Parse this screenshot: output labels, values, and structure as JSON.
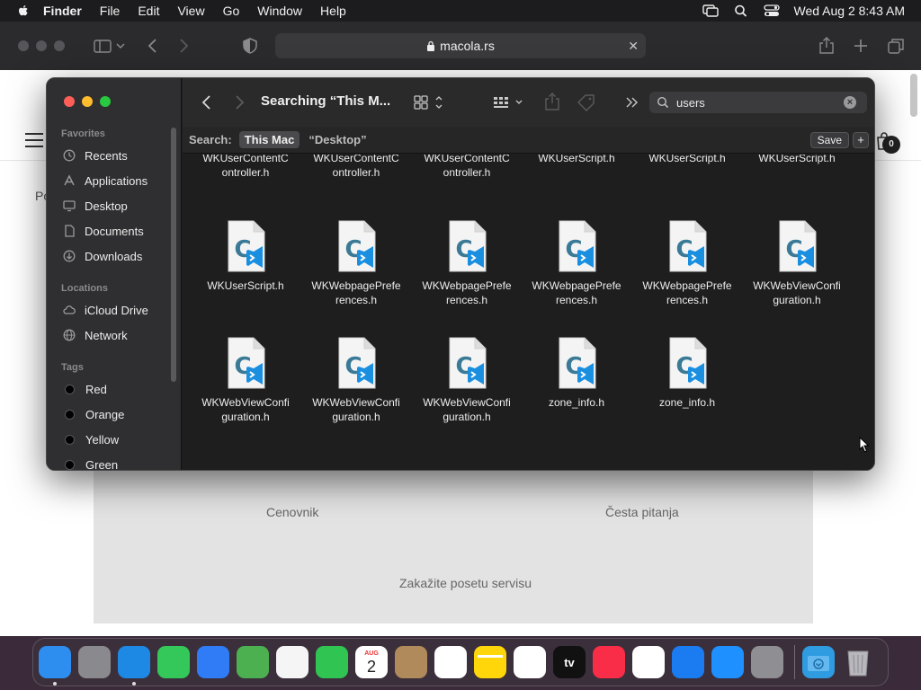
{
  "menubar": {
    "app": "Finder",
    "items": [
      "File",
      "Edit",
      "View",
      "Go",
      "Window",
      "Help"
    ],
    "datetime": "Wed Aug 2  8:43 AM"
  },
  "safari": {
    "url": "macola.rs",
    "cart_count": "0",
    "po_text": "Po",
    "links": {
      "pricing": "Cenovnik",
      "faq": "Česta pitanja",
      "service": "Zakažite posetu servisu"
    }
  },
  "finder": {
    "title": "Searching “This M...",
    "search_value": "users",
    "scope": {
      "label": "Search:",
      "selected": "This Mac",
      "other": "“Desktop”",
      "save": "Save",
      "add": "+"
    },
    "sidebar": {
      "favorites_header": "Favorites",
      "favorites": [
        {
          "label": "Recents",
          "icon": "clock-icon"
        },
        {
          "label": "Applications",
          "icon": "applications-icon"
        },
        {
          "label": "Desktop",
          "icon": "desktop-icon"
        },
        {
          "label": "Documents",
          "icon": "document-icon"
        },
        {
          "label": "Downloads",
          "icon": "download-icon"
        }
      ],
      "locations_header": "Locations",
      "locations": [
        {
          "label": "iCloud Drive",
          "icon": "cloud-icon"
        },
        {
          "label": "Network",
          "icon": "network-icon"
        }
      ],
      "tags_header": "Tags",
      "tags": [
        {
          "label": "Red"
        },
        {
          "label": "Orange"
        },
        {
          "label": "Yellow"
        },
        {
          "label": "Green"
        }
      ]
    },
    "files": [
      {
        "line1": "WKUserContentC",
        "line2": "ontroller.h",
        "partial": true
      },
      {
        "line1": "WKUserContentC",
        "line2": "ontroller.h",
        "partial": true
      },
      {
        "line1": "WKUserContentC",
        "line2": "ontroller.h",
        "partial": true
      },
      {
        "line1": "WKUserScript.h",
        "line2": "",
        "partial": true
      },
      {
        "line1": "WKUserScript.h",
        "line2": "",
        "partial": true
      },
      {
        "line1": "WKUserScript.h",
        "line2": "",
        "partial": true
      },
      {
        "line1": "WKUserScript.h",
        "line2": ""
      },
      {
        "line1": "WKWebpagePrefe",
        "line2": "rences.h"
      },
      {
        "line1": "WKWebpagePrefe",
        "line2": "rences.h"
      },
      {
        "line1": "WKWebpagePrefe",
        "line2": "rences.h"
      },
      {
        "line1": "WKWebpagePrefe",
        "line2": "rences.h"
      },
      {
        "line1": "WKWebViewConfi",
        "line2": "guration.h"
      },
      {
        "line1": "WKWebViewConfi",
        "line2": "guration.h"
      },
      {
        "line1": "WKWebViewConfi",
        "line2": "guration.h"
      },
      {
        "line1": "WKWebViewConfi",
        "line2": "guration.h"
      },
      {
        "line1": "zone_info.h",
        "line2": ""
      },
      {
        "line1": "zone_info.h",
        "line2": ""
      }
    ]
  },
  "dock": {
    "calendar_month": "AUG",
    "calendar_day": "2",
    "tv_label": "tv",
    "apps": [
      {
        "name": "Finder",
        "color": "#2d8ef0",
        "running": true
      },
      {
        "name": "Launchpad",
        "color": "#8a8a8e"
      },
      {
        "name": "Safari",
        "color": "#1e88e5",
        "running": true
      },
      {
        "name": "Messages",
        "color": "#34c759"
      },
      {
        "name": "Mail",
        "color": "#2f7cf6"
      },
      {
        "name": "Maps",
        "color": "#4caf50"
      },
      {
        "name": "Photos",
        "color": "#f5f5f5"
      },
      {
        "name": "FaceTime",
        "color": "#30c453"
      },
      {
        "name": "Calendar",
        "color": "#ffffff"
      },
      {
        "name": "Contacts",
        "color": "#b08a5a"
      },
      {
        "name": "Reminders",
        "color": "#ffffff"
      },
      {
        "name": "Notes",
        "color": "#ffd60a"
      },
      {
        "name": "Freeform",
        "color": "#ffffff"
      },
      {
        "name": "TV",
        "color": "#111111"
      },
      {
        "name": "Music",
        "color": "#fa2d48"
      },
      {
        "name": "News",
        "color": "#ffffff"
      },
      {
        "name": "Keynote",
        "color": "#1a7cf0"
      },
      {
        "name": "App Store",
        "color": "#1e90ff"
      },
      {
        "name": "System Settings",
        "color": "#8e8e93"
      }
    ]
  }
}
